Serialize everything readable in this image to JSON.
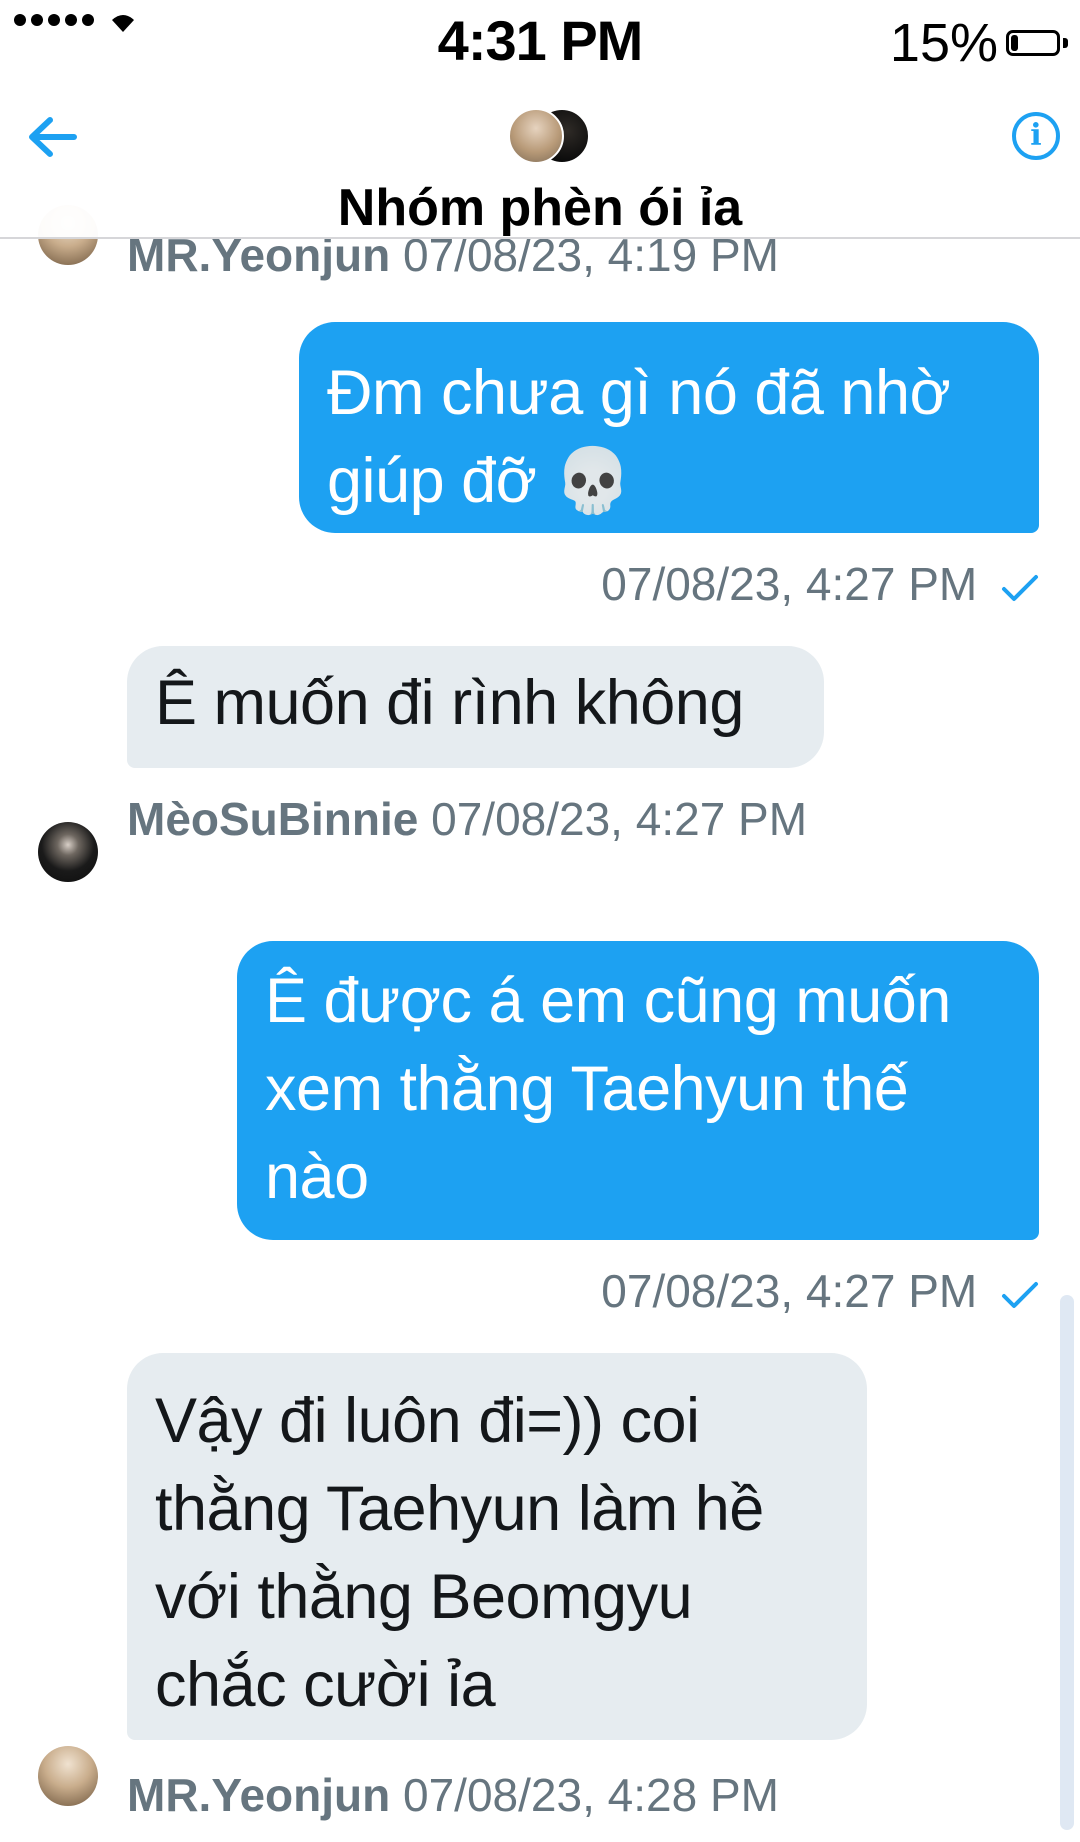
{
  "status_bar": {
    "time": "4:31 PM",
    "battery_percent": "15%",
    "battery_level": 0.15
  },
  "header": {
    "title": "Nhóm phèn ói ỉa",
    "back_icon": "back-arrow-icon",
    "info_icon": "info-icon",
    "info_glyph": "i"
  },
  "messages": [
    {
      "type": "meta",
      "sender": "MR.Yeonjun",
      "time": "07/08/23, 4:19 PM"
    },
    {
      "type": "sent",
      "text": "Đm chưa gì nó đã nhờ giúp đỡ 💀",
      "time": "07/08/23, 4:27 PM",
      "read_icon": "check-icon"
    },
    {
      "type": "recv",
      "text": "Ê muốn đi rình không",
      "sender": "MèoSuBinnie",
      "time": "07/08/23, 4:27 PM"
    },
    {
      "type": "sent",
      "text": "Ê được á em cũng muốn xem thằng Taehyun thế nào",
      "time": "07/08/23, 4:27 PM",
      "read_icon": "check-icon"
    },
    {
      "type": "recv",
      "text": "Vậy đi luôn đi=)) coi thằng Taehyun làm hề với thằng Beomgyu chắc cười ỉa",
      "sender": "MR.Yeonjun",
      "time": "07/08/23, 4:28 PM"
    }
  ],
  "colors": {
    "accent": "#1DA1F2",
    "received_bubble": "#e6ecf0",
    "meta_text": "#66757f"
  }
}
